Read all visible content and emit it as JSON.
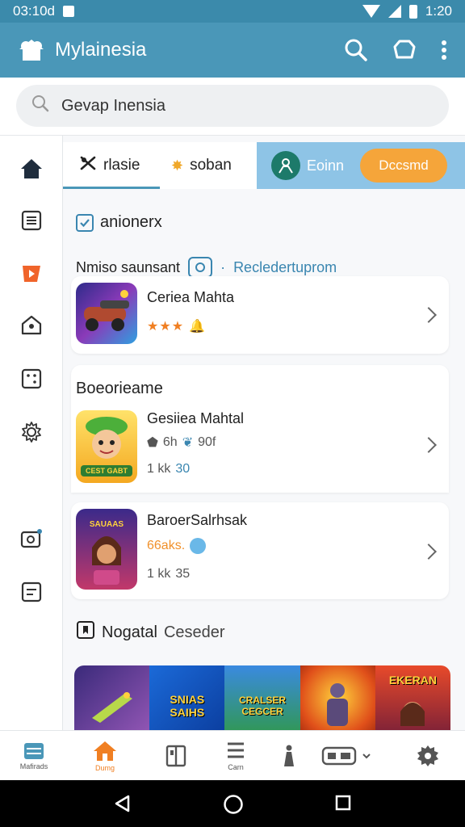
{
  "status_bar": {
    "time_left": "03:10d",
    "time_right": "1:20"
  },
  "app_bar": {
    "title": "Mylainesia",
    "icons": [
      "home-logo-icon",
      "search-icon",
      "puzzle-icon",
      "more-vert-icon"
    ]
  },
  "search": {
    "placeholder": "Gevap Inensia"
  },
  "tabs": [
    {
      "label": "rlasie",
      "icon": "crossed-icon"
    },
    {
      "label": "soban",
      "icon": "star-icon"
    }
  ],
  "tab_highlight": {
    "label": "Eoinn",
    "button_label": "Dccsmd"
  },
  "section1": {
    "title": "anionerx",
    "sub_label": "Nmiso saunsant",
    "sub_link": "Recledertuprom",
    "item": {
      "name": "Ceriea Mahta",
      "rating": "★★★",
      "badge": "🔔"
    }
  },
  "section2": {
    "title": "Boeorieame",
    "items": [
      {
        "name": "Gesiiea Mahtal",
        "meta1": "6h",
        "meta2": "90f",
        "size": "1 kk",
        "count": "30",
        "art_text": "CEST GABT"
      },
      {
        "name": "BaroerSalrhsak",
        "meta1": "66aks.",
        "size": "1 kk",
        "count": "35",
        "art_text": "SAUAAS"
      }
    ]
  },
  "section3": {
    "title": "Nogatal",
    "title_suffix": "Ceseder",
    "banner_labels": [
      "",
      "SNIAS\nSAIHS",
      "CRALSER\nCEGCER",
      "",
      "EKERAN"
    ]
  },
  "bottom_nav": {
    "items": [
      {
        "label": "Mafirads",
        "icon": "grid-list-icon"
      },
      {
        "label": "Dumg",
        "icon": "home-icon",
        "active": true
      },
      {
        "label": "",
        "icon": "book-icon"
      },
      {
        "label": "Carn",
        "icon": "list-icon"
      },
      {
        "label": "",
        "icon": "person-icon"
      },
      {
        "label": "",
        "icon": "gamepad-icon"
      },
      {
        "label": "",
        "icon": "settings-icon"
      }
    ]
  },
  "colors": {
    "primary": "#4a97b8",
    "status_bar": "#3b8aab",
    "accent": "#f5a53a",
    "active_nav": "#f07f22"
  }
}
